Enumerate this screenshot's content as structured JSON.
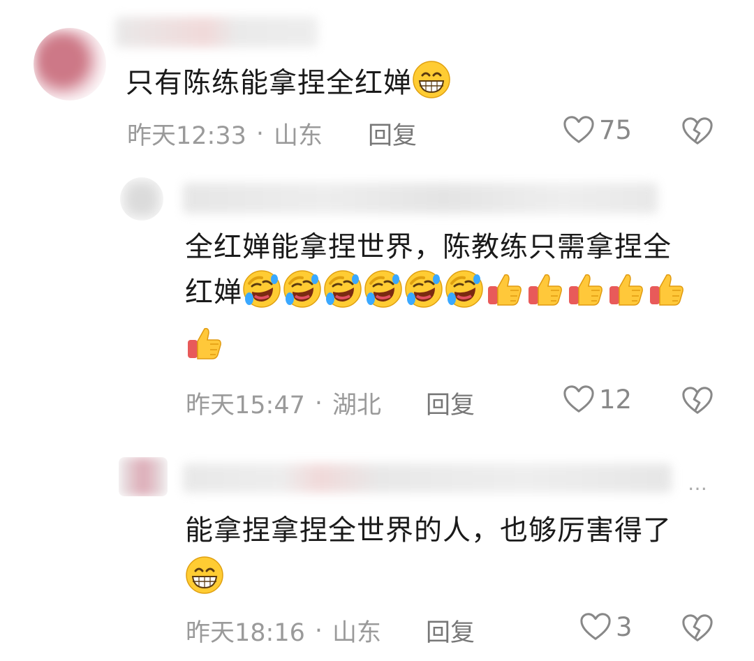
{
  "comments": [
    {
      "text": "只有陈练能拿捏全红婵",
      "emojis_after": [
        "grin-emoji"
      ],
      "time": "昨天12:33",
      "location": "山东",
      "reply_label": "回复",
      "likes": "75"
    },
    {
      "text_line1": "全红婵能拿捏世界，陈教练只需拿捏全",
      "text_line2": "红婵",
      "emojis_after": [
        "rofl-emoji",
        "rofl-emoji",
        "rofl-emoji",
        "rofl-emoji",
        "rofl-emoji",
        "rofl-emoji",
        "thumbs-up-emoji",
        "thumbs-up-emoji",
        "thumbs-up-emoji",
        "thumbs-up-emoji",
        "thumbs-up-emoji",
        "thumbs-up-emoji"
      ],
      "time": "昨天15:47",
      "location": "湖北",
      "reply_label": "回复",
      "likes": "12"
    },
    {
      "text": "能拿捏拿捏全世界的人，也够厉害得了",
      "emojis_after": [
        "grin-emoji"
      ],
      "time": "昨天18:16",
      "location": "山东",
      "reply_label": "回复",
      "likes": "3",
      "header_visible_suffix": "…"
    }
  ],
  "separator": "·",
  "colors": {
    "meta": "#9a9a9a",
    "text": "#1a1a1a",
    "icon": "#888888"
  }
}
